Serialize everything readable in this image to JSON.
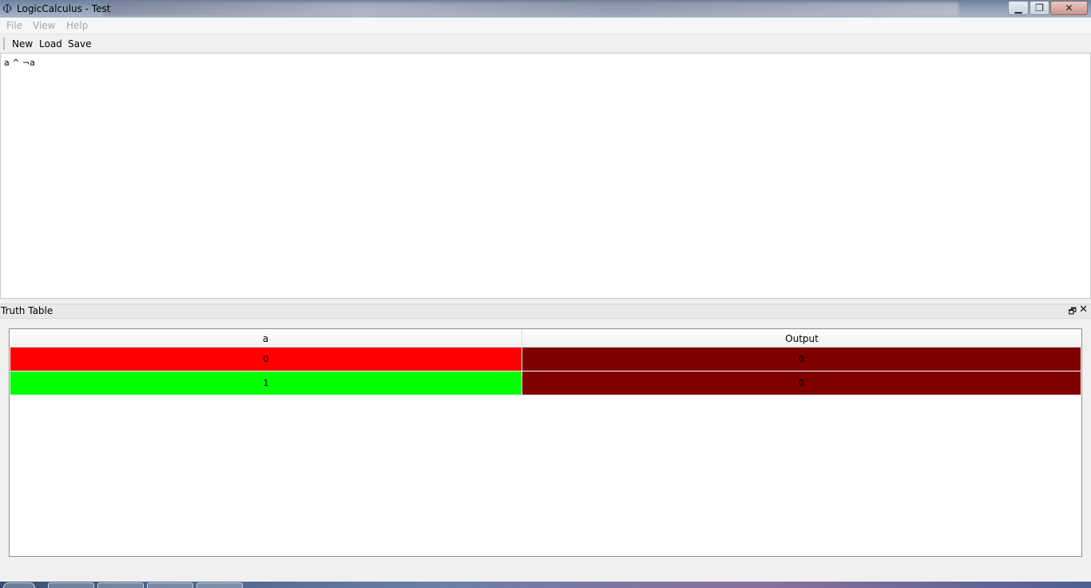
{
  "window": {
    "title": "LogicCalculus - Test",
    "app_icon": "Φ",
    "controls": {
      "minimize": "▁",
      "maximize": "❐",
      "close": "✕"
    }
  },
  "menu": {
    "items": [
      {
        "label": "File"
      },
      {
        "label": "View"
      },
      {
        "label": "Help"
      }
    ]
  },
  "toolbar": {
    "new_label": "New",
    "load_label": "Load",
    "save_label": "Save"
  },
  "editor": {
    "text": "a ^ ¬a"
  },
  "dock": {
    "title": "Truth Table",
    "float_icon": "🗗",
    "close_icon": "✕"
  },
  "truth_table": {
    "columns": [
      "a",
      "Output"
    ],
    "rows": [
      {
        "a": "0",
        "output": "0",
        "a_color": "#ff0000",
        "output_color": "#800000"
      },
      {
        "a": "1",
        "output": "0",
        "a_color": "#00ff00",
        "output_color": "#800000"
      }
    ]
  },
  "colors": {
    "false_input": "#ff0000",
    "true_input": "#00ff00",
    "false_output": "#800000"
  }
}
